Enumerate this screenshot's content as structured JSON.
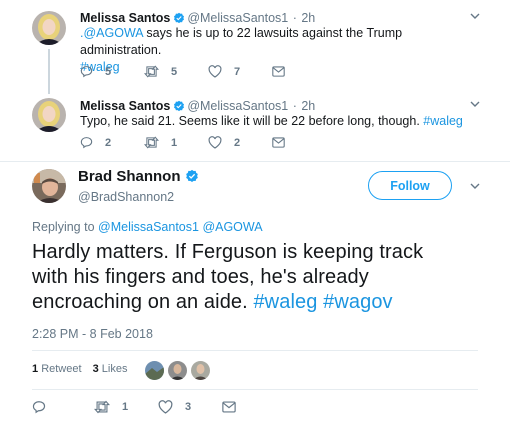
{
  "reply1": {
    "name": "Melissa Santos",
    "handle": "@MelissaSantos1",
    "sep": "·",
    "time": "2h",
    "mention": ".@AGOWA",
    "text": " says he is up to 22 lawsuits against the Trump administration.",
    "hashtag": "#waleg",
    "replies": "5",
    "retweets": "5",
    "likes": "7"
  },
  "reply2": {
    "name": "Melissa Santos",
    "handle": "@MelissaSantos1",
    "sep": "·",
    "time": "2h",
    "text": "Typo, he said 21. Seems like it will be 22 before long, though. ",
    "hashtag": "#waleg",
    "replies": "2",
    "retweets": "1",
    "likes": "2"
  },
  "main": {
    "name": "Brad Shannon",
    "handle": "@BradShannon2",
    "follow_label": "Follow",
    "replying_prefix": "Replying to ",
    "replying_to_1": "@MelissaSantos1",
    "replying_to_2": "@AGOWA",
    "text_line1": "Hardly matters. If Ferguson is keeping track",
    "text_line2": "with his fingers and toes, he's already",
    "text_line3": "encroaching on an aide. ",
    "hashtag1": "#waleg",
    "hashtag2": "#wagov",
    "timestamp": "2:28 PM - 8 Feb 2018",
    "retweet_count": "1",
    "retweet_label": "Retweet",
    "like_count": "3",
    "like_label": "Likes",
    "replies": "",
    "retweets": "1",
    "likes": "3"
  },
  "colors": {
    "accent": "#1da1f2",
    "link": "#1b95e0",
    "muted": "#657786",
    "divider": "#e6ecf0"
  }
}
